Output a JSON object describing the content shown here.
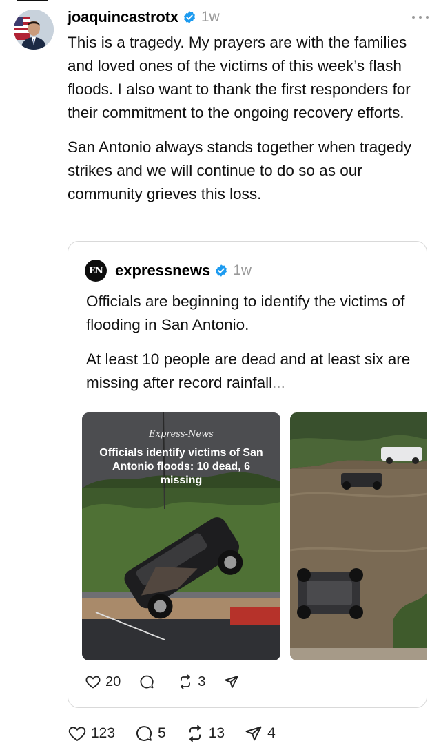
{
  "post": {
    "username": "joaquincastrotx",
    "time": "1w",
    "paragraphs": [
      "This is a tragedy. My prayers are with the families and loved ones of the victims of this week’s flash floods. I also want to thank the first responders for their commitment to the ongoing recovery efforts.",
      "San Antonio always stands together when tragedy strikes and we will continue to do so as our community grieves this loss."
    ],
    "icons": {
      "avatar": "avatar",
      "verified": "verified-badge-icon",
      "more": "more-options-icon"
    },
    "actions": {
      "likes": "123",
      "replies": "5",
      "reposts": "13",
      "shares": "4"
    }
  },
  "quote": {
    "logo_text": "EN",
    "username": "expressnews",
    "time": "1w",
    "paragraph1": "Officials are beginning to identify the victims of flooding in San Antonio.",
    "paragraph2": "At least 10 people are dead and at least six are missing after record rainfall",
    "ellipsis": "...",
    "media1": {
      "brand": "Express-News",
      "headline": "Officials identify victims of San Antonio floods: 10 dead, 6 missing"
    },
    "actions": {
      "likes": "20",
      "replies": "",
      "reposts": "3",
      "shares": ""
    }
  },
  "colors": {
    "verified_blue": "#1d9bf0",
    "muted": "#9a9a9a",
    "border": "#d9d9d9"
  }
}
